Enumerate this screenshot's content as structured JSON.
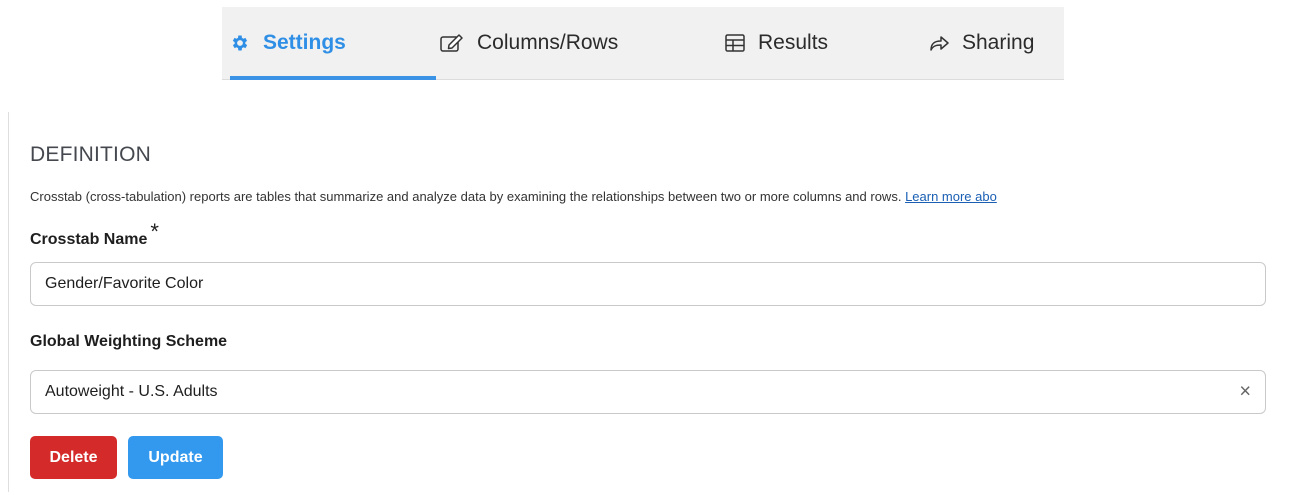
{
  "tabs": [
    {
      "label": "Settings",
      "icon": "gear-icon",
      "active": true
    },
    {
      "label": "Columns/Rows",
      "icon": "edit-icon",
      "active": false
    },
    {
      "label": "Results",
      "icon": "table-icon",
      "active": false
    },
    {
      "label": "Sharing",
      "icon": "share-icon",
      "active": false
    }
  ],
  "definition": {
    "title": "DEFINITION",
    "description": "Crosstab (cross-tabulation) reports are tables that summarize and analyze data by examining the relationships between two or more columns and rows.",
    "learn_more": "Learn more abo"
  },
  "crosstab_name": {
    "label": "Crosstab Name",
    "required_mark": "*",
    "value": "Gender/Favorite Color"
  },
  "weighting": {
    "label": "Global Weighting Scheme",
    "value": "Autoweight - U.S. Adults",
    "clear": "×"
  },
  "buttons": {
    "delete": "Delete",
    "update": "Update"
  },
  "colors": {
    "accent": "#2f8fe6",
    "danger": "#d42a2a",
    "primary": "#3399ee"
  }
}
